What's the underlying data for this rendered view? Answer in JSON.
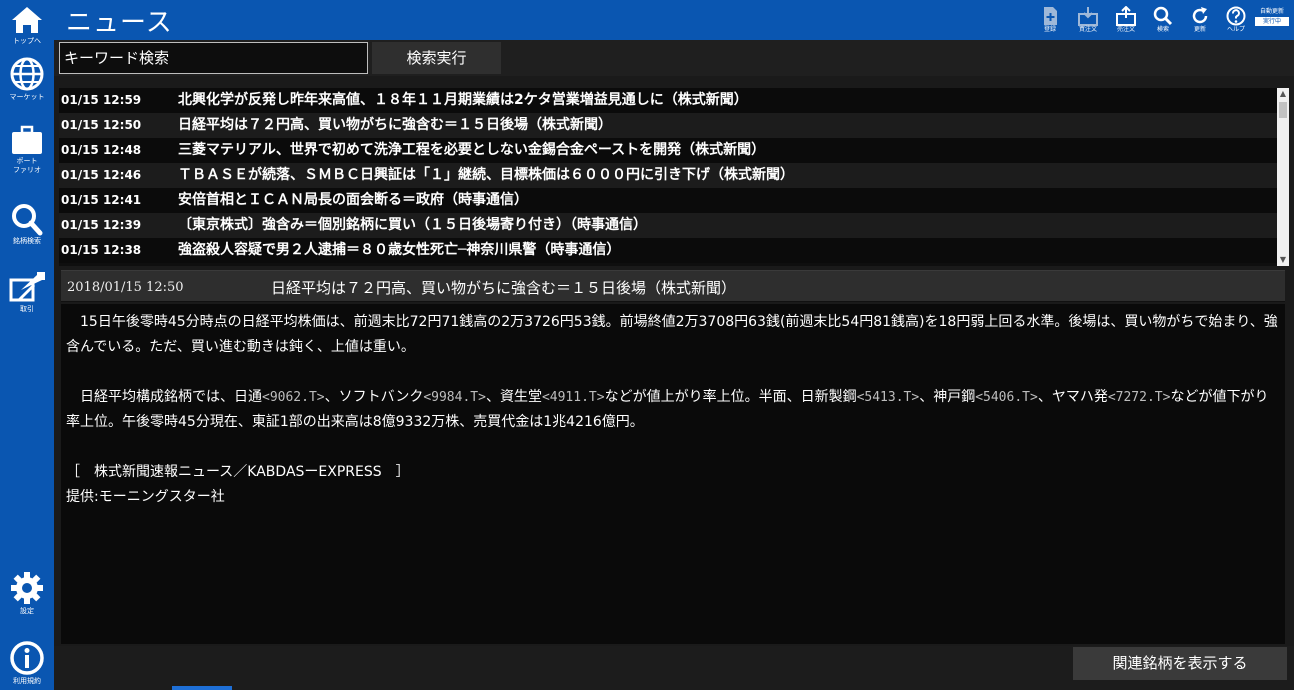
{
  "sidebar": {
    "items": [
      {
        "label": "トップへ",
        "icon": "home-icon"
      },
      {
        "label": "マーケット",
        "icon": "globe-icon"
      },
      {
        "label": "ポート\nファリオ",
        "icon": "briefcase-icon"
      },
      {
        "label": "銘柄検索",
        "icon": "search-icon"
      },
      {
        "label": "取引",
        "icon": "trade-icon"
      },
      {
        "label": "設定",
        "icon": "gear-icon"
      },
      {
        "label": "利用規約",
        "icon": "info-icon"
      }
    ]
  },
  "header": {
    "title": "ニュース",
    "tools": [
      {
        "label": "登録",
        "icon": "register-icon"
      },
      {
        "label": "買注文",
        "icon": "buy-order-icon"
      },
      {
        "label": "売注文",
        "icon": "sell-order-icon"
      },
      {
        "label": "検索",
        "icon": "search-icon"
      },
      {
        "label": "更新",
        "icon": "refresh-icon"
      },
      {
        "label": "ヘルプ",
        "icon": "help-icon"
      }
    ],
    "auto_refresh_label": "自動更新",
    "auto_refresh_status": "実行中"
  },
  "search": {
    "value": "キーワード検索",
    "button_label": "検索実行"
  },
  "news_list": [
    {
      "time": "01/15 12:59",
      "title": "北興化学が反発し昨年来高値、１８年１１月期業績は2ケタ営業増益見通しに（株式新聞）"
    },
    {
      "time": "01/15 12:50",
      "title": "日経平均は７２円高、買い物がちに強含む＝１５日後場（株式新聞）"
    },
    {
      "time": "01/15 12:48",
      "title": "三菱マテリアル、世界で初めて洗浄工程を必要としない金錫合金ペーストを開発（株式新聞）"
    },
    {
      "time": "01/15 12:46",
      "title": "ＴＢＡＳＥが続落、ＳＭＢＣ日興証は「１」継続、目標株価は６０００円に引き下げ（株式新聞）"
    },
    {
      "time": "01/15 12:41",
      "title": "安倍首相とＩＣＡＮ局長の面会断る＝政府（時事通信）"
    },
    {
      "time": "01/15 12:39",
      "title": "〔東京株式〕強含み＝個別銘柄に買い（１５日後場寄り付き）（時事通信）"
    },
    {
      "time": "01/15 12:38",
      "title": "強盗殺人容疑で男２人逮捕＝８０歳女性死亡─神奈川県警（時事通信）"
    }
  ],
  "detail": {
    "datetime": "2018/01/15 12:50",
    "title": "日経平均は７２円高、買い物がちに強含む＝１５日後場（株式新聞）",
    "p1": "　15日午後零時45分時点の日経平均株価は、前週末比72円71銭高の2万3726円53銭。前場終値2万3708円63銭(前週末比54円81銭高)を18円弱上回る水準。後場は、買い物がちで始まり、強含んでいる。ただ、買い進む動きは鈍く、上値は重い。",
    "p2": {
      "lead": "　日経平均構成銘柄では、日通",
      "code1": "<9062.T>",
      "s1": "、ソフトバンク",
      "code2": "<9984.T>",
      "s2": "、資生堂",
      "code3": "<4911.T>",
      "s3": "などが値上がり率上位。半面、日新製鋼",
      "code4": "<5413.T>",
      "s4": "、神戸鋼",
      "code5": "<5406.T>",
      "s5": "、ヤマハ発",
      "code6": "<7272.T>",
      "s6": "などが値下がり率上位。午後零時45分現在、東証1部の出来高は8億9332万株、売買代金は1兆4216億円。"
    },
    "source": "［　株式新聞速報ニュース／KABDASーEXPRESS　］",
    "provider": "提供:モーニングスター社"
  },
  "related_button_label": "関連銘柄を表示する"
}
